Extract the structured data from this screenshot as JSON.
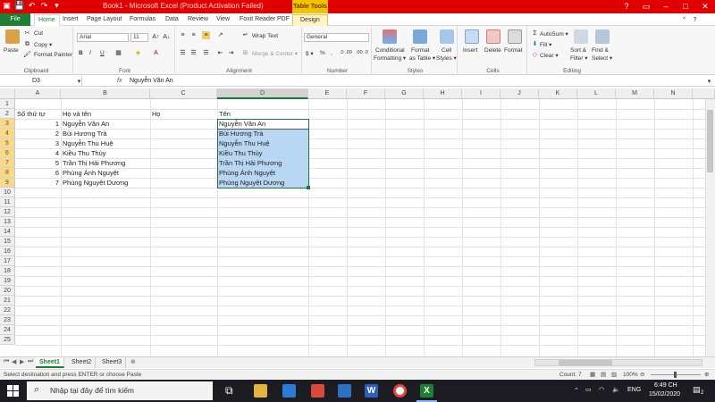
{
  "titlebar": {
    "title": "Book1 - Microsoft Excel (Product Activation Failed)",
    "table_tools": "Table Tools",
    "qat_icons": [
      "save-icon",
      "undo-icon",
      "redo-icon",
      "dropdown-icon"
    ],
    "accent": "#e00000"
  },
  "tabs": [
    "File",
    "Home",
    "Insert",
    "Page Layout",
    "Formulas",
    "Data",
    "Review",
    "View",
    "Foxit Reader PDF",
    "Design"
  ],
  "ribbon": {
    "clipboard": {
      "paste": "Paste",
      "cut": "Cut",
      "copy": "Copy ▾",
      "format_painter": "Format Painter",
      "label": "Clipboard"
    },
    "font": {
      "name": "Arial",
      "size": "11",
      "bold": "B",
      "italic": "I",
      "underline": "U",
      "label": "Font"
    },
    "alignment": {
      "wrap": "Wrap Text",
      "merge": "Merge & Center ▾",
      "label": "Alignment"
    },
    "number": {
      "format": "General",
      "label": "Number",
      "currency": "$ ▾",
      "percent": "%",
      "comma": ",",
      "inc_dec": ".0 .00",
      "dec_dec": ".00 .0"
    },
    "styles": {
      "conditional": "Conditional",
      "conditional2": "Formatting ▾",
      "format_table": "Format",
      "format_table2": "as Table ▾",
      "cell_styles": "Cell",
      "cell_styles2": "Styles ▾",
      "label": "Styles"
    },
    "cells": {
      "insert": "Insert",
      "delete": "Delete",
      "format": "Format",
      "label": "Cells"
    },
    "editing": {
      "autosum": "AutoSum ▾",
      "fill": "Fill ▾",
      "clear": "Clear ▾",
      "sort": "Sort &",
      "sort2": "Filter ▾",
      "find": "Find &",
      "find2": "Select ▾",
      "label": "Editing"
    }
  },
  "formula_bar": {
    "name_box": "D3",
    "fx": "fx",
    "value": "Nguyễn Văn An"
  },
  "columns": [
    "A",
    "B",
    "C",
    "D",
    "E",
    "F",
    "G",
    "H",
    "I",
    "J",
    "K",
    "L",
    "M",
    "N"
  ],
  "rows": [
    "1",
    "2",
    "3",
    "4",
    "5",
    "6",
    "7",
    "8",
    "9",
    "10",
    "11",
    "12",
    "13",
    "14",
    "15",
    "16",
    "17",
    "18",
    "19",
    "20",
    "21",
    "22",
    "23",
    "24",
    "25"
  ],
  "headers": {
    "a": "Số thứ tự",
    "b": "Họ và tên",
    "c": "Họ",
    "d": "Tên"
  },
  "data_rows": [
    {
      "no": "1",
      "full": "Nguyễn Văn An",
      "ten": "Nguyễn Văn An"
    },
    {
      "no": "2",
      "full": "Bùi Hương Trà",
      "ten": "Bùi Hương Trà"
    },
    {
      "no": "3",
      "full": "Nguyễn Thu Huệ",
      "ten": "Nguyễn Thu Huệ"
    },
    {
      "no": "4",
      "full": "Kiều Thu Thủy",
      "ten": "Kiều Thu Thủy"
    },
    {
      "no": "5",
      "full": "Trần Thị Hải Phương",
      "ten": "Trần Thị Hải Phương"
    },
    {
      "no": "6",
      "full": "Phùng Ánh Nguyệt",
      "ten": "Phùng Ánh Nguyệt"
    },
    {
      "no": "7",
      "full": "Phùng Nguyệt Dương",
      "ten": "Phùng Nguyệt Dương"
    }
  ],
  "sheets": [
    "Sheet1",
    "Sheet2",
    "Sheet3"
  ],
  "status": {
    "message": "Select destination and press ENTER or choose Paste",
    "count": "Count: 7",
    "zoom": "100%"
  },
  "taskbar": {
    "search_placeholder": "Nhập tại đây để tìm kiếm",
    "lang": "ENG",
    "time": "6:49 CH",
    "date": "15/02/2020",
    "notifications": "2"
  }
}
